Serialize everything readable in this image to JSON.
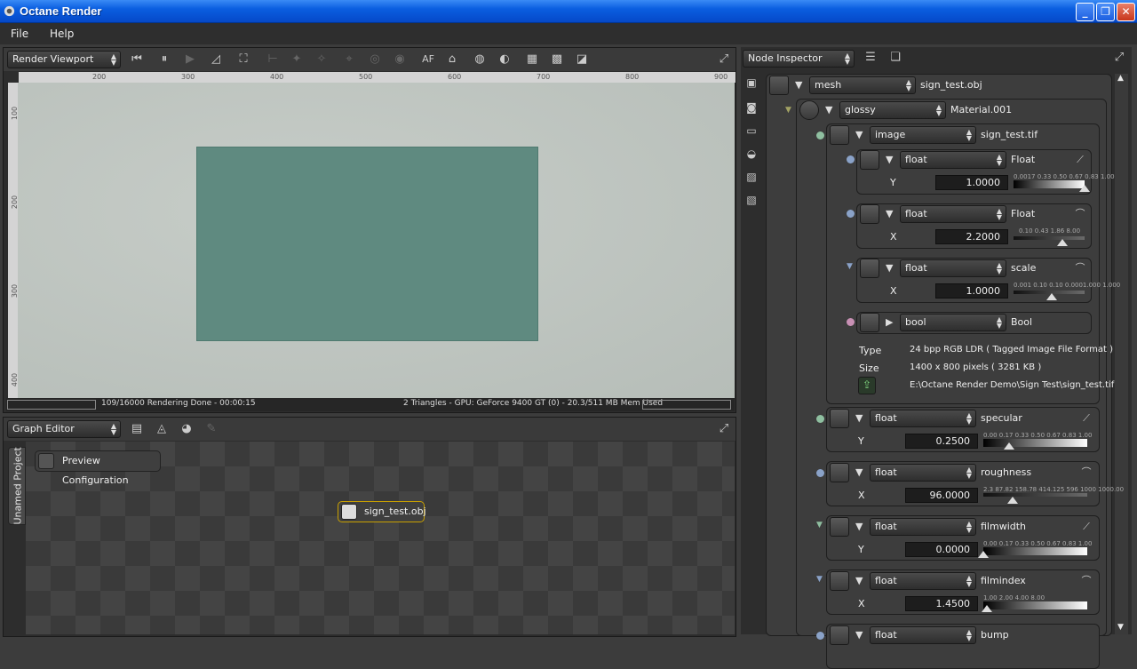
{
  "window": {
    "title": "Octane Render",
    "min": "_",
    "max": "❐",
    "close": "✕"
  },
  "menu": {
    "file": "File",
    "help": "Help"
  },
  "viewport": {
    "dropdown": "Render Viewport",
    "toolbar_af": "AF",
    "ruler_h": [
      "200",
      "300",
      "400",
      "500",
      "600",
      "700",
      "800",
      "900"
    ],
    "ruler_v": [
      "100",
      "200",
      "300",
      "400"
    ],
    "status_left": "109/16000 Rendering Done - 00:00:15",
    "status_right": "2 Triangles - GPU: GeForce 9400 GT (0) - 20.3/511 MB Mem Used"
  },
  "graph": {
    "dropdown": "Graph Editor",
    "tab": "Unamed Project",
    "node_preview": "Preview Configuration",
    "node_mesh": "sign_test.obj"
  },
  "inspector": {
    "dropdown": "Node Inspector",
    "mesh": {
      "type": "mesh",
      "name": "sign_test.obj"
    },
    "material": {
      "type": "glossy",
      "name": "Material.001"
    },
    "image": {
      "type": "image",
      "name": "sign_test.tif",
      "params": [
        {
          "type": "float",
          "name": "Float",
          "axis": "Y",
          "value": "1.0000",
          "scale": "0.0017 0.33 0.50 0.67 0.83 1.00",
          "pos": 1.0
        },
        {
          "type": "float",
          "name": "Float",
          "axis": "X",
          "value": "2.2000",
          "scale": "0.10 0.43 1.86 8.00",
          "pos": 0.66
        },
        {
          "type": "float",
          "name": "scale",
          "axis": "X",
          "value": "1.0000",
          "scale": "0.001 0.10 0.10 0.0001.000 1.000",
          "pos": 0.5
        }
      ],
      "bool": {
        "type": "bool",
        "name": "Bool"
      },
      "info": {
        "type_label": "Type",
        "type_value": "24 bpp RGB LDR ( Tagged Image File Format )",
        "size_label": "Size",
        "size_value": "1400 x 800 pixels ( 3281 KB )",
        "path": "E:\\Octane Render Demo\\Sign Test\\sign_test.tif"
      }
    },
    "params": [
      {
        "type": "float",
        "name": "specular",
        "axis": "Y",
        "value": "0.2500",
        "scale": "0.00 0.17 0.33 0.50 0.67 0.83 1.00",
        "pos": 0.25
      },
      {
        "type": "float",
        "name": "roughness",
        "axis": "X",
        "value": "96.0000",
        "scale": "2.3 87.82 158.78 414.125 596 1000 1000.00",
        "pos": 0.28
      },
      {
        "type": "float",
        "name": "filmwidth",
        "axis": "Y",
        "value": "0.0000",
        "scale": "0.00 0.17 0.33 0.50 0.67 0.83 1.00",
        "pos": 0.0
      },
      {
        "type": "float",
        "name": "filmindex",
        "axis": "X",
        "value": "1.4500",
        "scale": "1.00 2.00 4.00 8.00",
        "pos": 0.03
      },
      {
        "type": "float",
        "name": "bump"
      }
    ]
  },
  "colors": {
    "titlebar": "#0a5ee0",
    "panel": "#2d2d2d",
    "render_rect": "#5f8a80"
  }
}
